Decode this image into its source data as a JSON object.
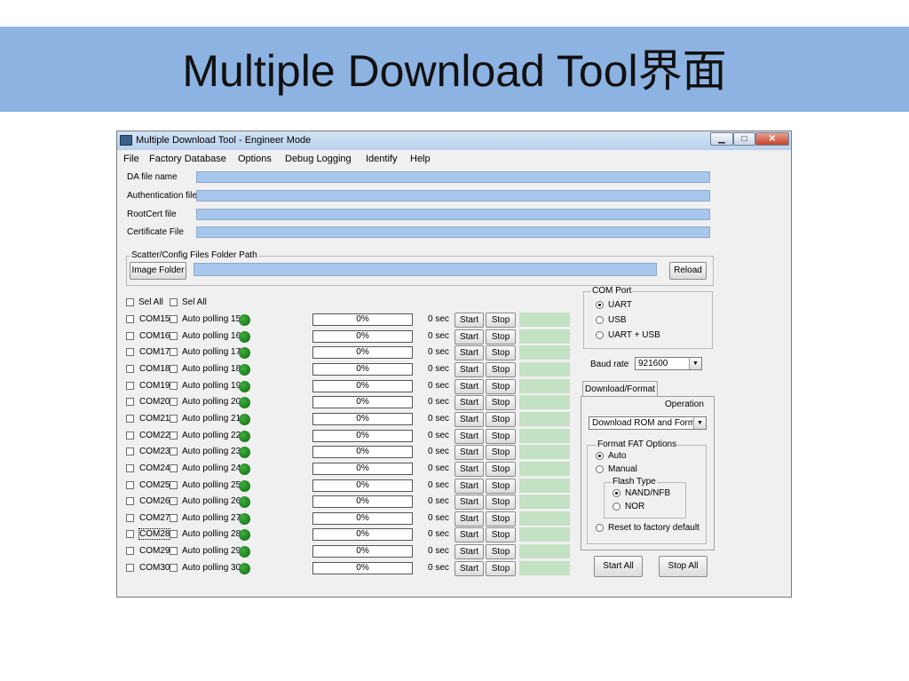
{
  "slide": {
    "title": "Multiple Download Tool界面",
    "banner_color": "#8db3e2"
  },
  "window": {
    "title": "Multiple Download Tool - Engineer Mode",
    "icon": "app-icon",
    "controls": {
      "minimize": "▁",
      "maximize": "□",
      "close": "✕"
    }
  },
  "menu": [
    "File",
    "Factory Database",
    "Options",
    "Debug Logging",
    "Identify",
    "Help"
  ],
  "files": {
    "da_label": "DA file name",
    "auth_label": "Authentication file",
    "rootcert_label": "RootCert file",
    "cert_label": "Certificate File"
  },
  "scatter": {
    "legend": "Scatter/Config Files Folder Path",
    "image_folder": "Image Folder",
    "reload": "Reload"
  },
  "sel_all": [
    "Sel All",
    "Sel All"
  ],
  "ports": [
    {
      "com": "COM15",
      "auto": "Auto polling 15",
      "progress": "0%",
      "time": "0 sec"
    },
    {
      "com": "COM16",
      "auto": "Auto polling 16",
      "progress": "0%",
      "time": "0 sec"
    },
    {
      "com": "COM17",
      "auto": "Auto polling 17",
      "progress": "0%",
      "time": "0 sec"
    },
    {
      "com": "COM18",
      "auto": "Auto polling 18",
      "progress": "0%",
      "time": "0 sec"
    },
    {
      "com": "COM19",
      "auto": "Auto polling 19",
      "progress": "0%",
      "time": "0 sec"
    },
    {
      "com": "COM20",
      "auto": "Auto polling 20",
      "progress": "0%",
      "time": "0 sec"
    },
    {
      "com": "COM21",
      "auto": "Auto polling 21",
      "progress": "0%",
      "time": "0 sec"
    },
    {
      "com": "COM22",
      "auto": "Auto polling 22",
      "progress": "0%",
      "time": "0 sec"
    },
    {
      "com": "COM23",
      "auto": "Auto polling 23",
      "progress": "0%",
      "time": "0 sec"
    },
    {
      "com": "COM24",
      "auto": "Auto polling 24",
      "progress": "0%",
      "time": "0 sec"
    },
    {
      "com": "COM25",
      "auto": "Auto polling 25",
      "progress": "0%",
      "time": "0 sec"
    },
    {
      "com": "COM26",
      "auto": "Auto polling 26",
      "progress": "0%",
      "time": "0 sec"
    },
    {
      "com": "COM27",
      "auto": "Auto polling 27",
      "progress": "0%",
      "time": "0 sec"
    },
    {
      "com": "COM28",
      "auto": "Auto polling 28",
      "progress": "0%",
      "time": "0 sec"
    },
    {
      "com": "COM29",
      "auto": "Auto polling 29",
      "progress": "0%",
      "time": "0 sec"
    },
    {
      "com": "COM30",
      "auto": "Auto polling 30",
      "progress": "0%",
      "time": "0 sec"
    }
  ],
  "row_buttons": {
    "start": "Start",
    "stop": "Stop"
  },
  "colors": {
    "led": "#138a13",
    "status_cell": "#c3e1c3",
    "path_field": "#a7c7ec"
  },
  "com_port": {
    "legend": "COM Port",
    "options": [
      "UART",
      "USB",
      "UART + USB"
    ],
    "selected": "UART"
  },
  "baud": {
    "label": "Baud rate",
    "value": "921600"
  },
  "tab": {
    "label": "Download/Format"
  },
  "operation": {
    "label": "Operation",
    "value": "Download ROM and Format"
  },
  "format_fat": {
    "legend": "Format FAT Options",
    "auto": "Auto",
    "manual": "Manual",
    "selected": "Auto",
    "flash_legend": "Flash  Type",
    "nand": "NAND/NFB",
    "nor": "NOR",
    "flash_selected": "NAND/NFB",
    "reset": "Reset to factory default"
  },
  "actions": {
    "start_all": "Start All",
    "stop_all": "Stop All"
  }
}
